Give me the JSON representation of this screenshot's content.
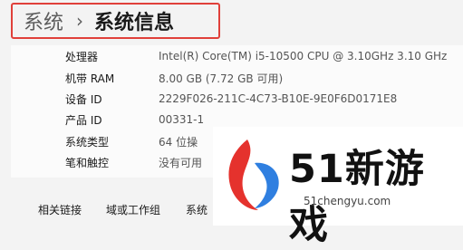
{
  "breadcrumb": {
    "parent": "系统",
    "separator": "›",
    "current": "系统信息"
  },
  "specs": [
    {
      "label": "处理器",
      "value": "Intel(R) Core(TM) i5-10500 CPU @ 3.10GHz   3.10 GHz"
    },
    {
      "label": "机带 RAM",
      "value": "8.00 GB (7.72 GB 可用)"
    },
    {
      "label": "设备 ID",
      "value": "2229F026-211C-4C73-B10E-9E0F6D0171E8"
    },
    {
      "label": "产品 ID",
      "value": "00331-1"
    },
    {
      "label": "系统类型",
      "value": "64 位操"
    },
    {
      "label": "笔和触控",
      "value": "没有可用"
    }
  ],
  "footer": {
    "related_label": "相关链接",
    "links": [
      "域或工作组",
      "系统"
    ]
  },
  "watermark": {
    "text": "51新游戏",
    "url": "51chengyu.com"
  },
  "colors": {
    "highlight_border": "#e0403a",
    "logo_red": "#e5322d",
    "logo_blue": "#2f7fe0"
  }
}
